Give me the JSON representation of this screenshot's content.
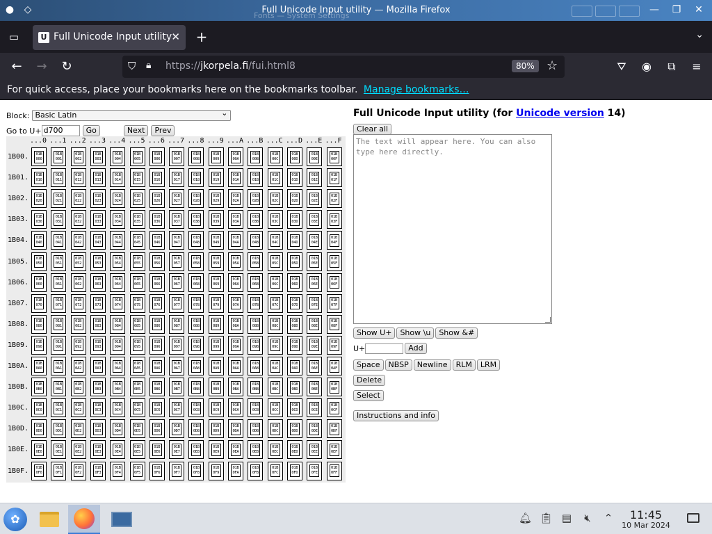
{
  "window": {
    "title": "Full Unicode Input utility — Mozilla Firefox",
    "ghost_title": "Fonts — System Settings"
  },
  "tabs": [
    {
      "favicon": "U",
      "label": "Full Unicode Input utility",
      "close": "✕"
    }
  ],
  "navbar": {
    "url_prefix": "https://",
    "url_host": "jkorpela.fi",
    "url_path": "/fui.html8",
    "zoom": "80%"
  },
  "bookmarks": {
    "text": "For quick access, place your bookmarks here on the bookmarks toolbar.",
    "link": "Manage bookmarks…"
  },
  "left": {
    "block_label": "Block:",
    "block_value": "Basic Latin",
    "goto_label": "Go to U+",
    "goto_value": "d700",
    "go": "Go",
    "next": "Next",
    "prev": "Prev"
  },
  "grid": {
    "prefix": "1B",
    "columns": [
      "0",
      "1",
      "2",
      "3",
      "4",
      "5",
      "6",
      "7",
      "8",
      "9",
      "A",
      "B",
      "C",
      "D",
      "E",
      "F"
    ],
    "rows": [
      "1B00.",
      "1B01.",
      "1B02.",
      "1B03.",
      "1B04.",
      "1B05.",
      "1B06.",
      "1B07.",
      "1B08.",
      "1B09.",
      "1B0A.",
      "1B0B.",
      "1B0C.",
      "1B0D.",
      "1B0E.",
      "1B0F."
    ]
  },
  "right": {
    "title_pre": "Full Unicode Input utility (for ",
    "title_link": "Unicode version",
    "title_post": " 14)",
    "clear_all": "Clear all",
    "placeholder": "The text will appear here. You can also type here directly.",
    "show_u": "Show U+",
    "show_backslash_u": "Show \\u",
    "show_amp": "Show &#",
    "u_label": "U+",
    "add": "Add",
    "space": "Space",
    "nbsp": "NBSP",
    "newline": "Newline",
    "rlm": "RLM",
    "lrm": "LRM",
    "delete": "Delete",
    "select": "Select",
    "instructions": "Instructions and info"
  },
  "taskbar": {
    "time": "11:45",
    "date": "10 Mar 2024"
  },
  "colors": {
    "titlebar": "#3b6aa0",
    "toolbar": "#2b2a33",
    "tabstrip": "#1c1b22",
    "link": "#0000ee",
    "bookmark_link": "#00ddff"
  }
}
